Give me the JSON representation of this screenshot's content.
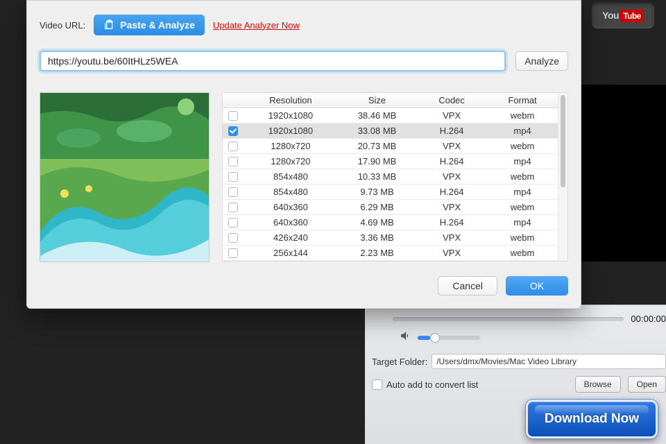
{
  "youtube_brand": {
    "you": "You",
    "tube": "Tube"
  },
  "dialog": {
    "video_url_label": "Video URL:",
    "paste_analyze_label": "Paste & Analyze",
    "update_link": "Update Analyzer Now",
    "url_value": "https://youtu.be/60ItHLz5WEA",
    "analyze_label": "Analyze",
    "columns": {
      "resolution": "Resolution",
      "size": "Size",
      "codec": "Codec",
      "format": "Format"
    },
    "rows": [
      {
        "checked": false,
        "resolution": "1920x1080",
        "size": "38.46 MB",
        "codec": "VPX",
        "format": "webm"
      },
      {
        "checked": true,
        "resolution": "1920x1080",
        "size": "33.08 MB",
        "codec": "H.264",
        "format": "mp4"
      },
      {
        "checked": false,
        "resolution": "1280x720",
        "size": "20.73 MB",
        "codec": "VPX",
        "format": "webm"
      },
      {
        "checked": false,
        "resolution": "1280x720",
        "size": "17.90 MB",
        "codec": "H.264",
        "format": "mp4"
      },
      {
        "checked": false,
        "resolution": "854x480",
        "size": "10.33 MB",
        "codec": "VPX",
        "format": "webm"
      },
      {
        "checked": false,
        "resolution": "854x480",
        "size": "9.73 MB",
        "codec": "H.264",
        "format": "mp4"
      },
      {
        "checked": false,
        "resolution": "640x360",
        "size": "6.29 MB",
        "codec": "VPX",
        "format": "webm"
      },
      {
        "checked": false,
        "resolution": "640x360",
        "size": "4.69 MB",
        "codec": "H.264",
        "format": "mp4"
      },
      {
        "checked": false,
        "resolution": "426x240",
        "size": "3.36 MB",
        "codec": "VPX",
        "format": "webm"
      },
      {
        "checked": false,
        "resolution": "256x144",
        "size": "2.23 MB",
        "codec": "VPX",
        "format": "webm"
      }
    ],
    "cancel_label": "Cancel",
    "ok_label": "OK"
  },
  "bottom": {
    "time": "00:00:00",
    "target_folder_label": "Target Folder:",
    "target_folder_value": "/Users/dmx/Movies/Mac Video Library",
    "auto_add_label": "Auto add to convert list",
    "browse_label": "Browse",
    "open_label": "Open",
    "download_label": "Download Now"
  }
}
